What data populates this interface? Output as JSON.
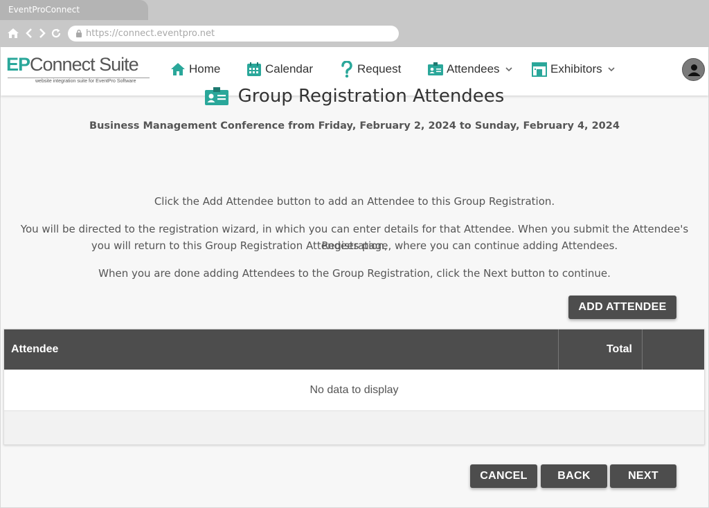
{
  "browser": {
    "tab_title": "EventProConnect",
    "url": "https://connect.eventpro.net"
  },
  "brand": {
    "logo_ep": "EP",
    "logo_name": "Connect Suite",
    "logo_tagline": "website integration suite for EventPro Software",
    "accent_color": "#2aa79a"
  },
  "nav": {
    "items": [
      {
        "label": "Home",
        "icon": "home-icon"
      },
      {
        "label": "Calendar",
        "icon": "calendar-icon"
      },
      {
        "label": "Request",
        "icon": "question-icon"
      },
      {
        "label": "Attendees",
        "icon": "id-card-icon",
        "dropdown": true
      },
      {
        "label": "Exhibitors",
        "icon": "booth-icon",
        "dropdown": true
      }
    ],
    "user_icon": "user-avatar-icon"
  },
  "page": {
    "title": "Group Registration Attendees",
    "subtitle": "Business Management Conference from Friday, February 2, 2024 to Sunday, February 4, 2024",
    "instruction_1": "Click the Add Attendee button to add an Attendee to this Group Registration.",
    "instruction_2a": "You will be directed to the registration wizard, in which you can enter details for that Attendee. When you submit the Attendee's Registration,",
    "instruction_2b": "you will return to this Group Registration Attendees page, where you can continue adding Attendees.",
    "instruction_3": "When you are done adding Attendees to the Group Registration, click the Next button to continue."
  },
  "actions": {
    "add_attendee": "ADD ATTENDEE",
    "cancel": "CANCEL",
    "back": "BACK",
    "next": "NEXT"
  },
  "grid": {
    "columns": [
      "Attendee",
      "Total",
      ""
    ],
    "empty_message": "No data to display"
  }
}
